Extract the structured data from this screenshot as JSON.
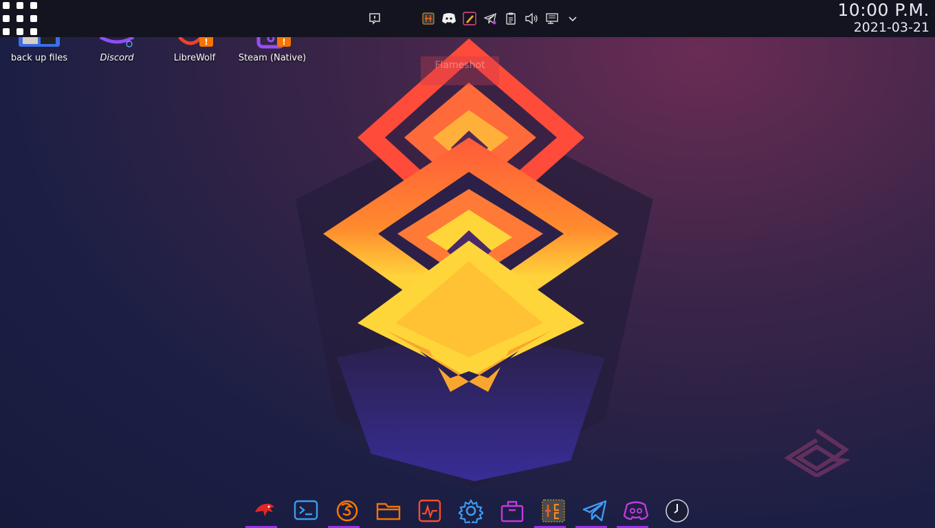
{
  "panel": {
    "clock": {
      "time": "10:00 P.M.",
      "date": "2021-03-21"
    },
    "tray_icons": [
      "notification-icon",
      "cpu-monitor-icon",
      "discord-icon",
      "draw-icon",
      "telegram-icon",
      "clipboard-icon",
      "volume-icon",
      "network-icon",
      "expand-tray-icon"
    ]
  },
  "desktop": {
    "icons": [
      {
        "label": "back up files",
        "icon": "folder-backup-icon"
      },
      {
        "label": "Discord",
        "icon": "discord-icon"
      },
      {
        "label": "LibreWolf",
        "icon": "librewolf-icon",
        "badge": "!"
      },
      {
        "label": "Steam (Native)",
        "icon": "steam-icon",
        "badge": "!"
      }
    ],
    "tooltip": "Flameshot"
  },
  "dock": {
    "items": [
      {
        "name": "eagle-app-icon",
        "running": true
      },
      {
        "name": "terminal-icon",
        "running": false
      },
      {
        "name": "firefox-icon",
        "running": true
      },
      {
        "name": "file-manager-icon",
        "running": false
      },
      {
        "name": "system-monitor-icon",
        "running": false
      },
      {
        "name": "settings-icon",
        "running": false
      },
      {
        "name": "store-icon",
        "running": false
      },
      {
        "name": "cpu-x-icon",
        "running": true
      },
      {
        "name": "telegram-icon",
        "running": true
      },
      {
        "name": "discord-icon",
        "running": true
      },
      {
        "name": "clock-icon",
        "running": false
      }
    ]
  },
  "colors": {
    "accent": "#9b2cf0",
    "panel": "#13141f",
    "dock_blue": "#3d9cf2",
    "dock_orange": "#f67400"
  }
}
